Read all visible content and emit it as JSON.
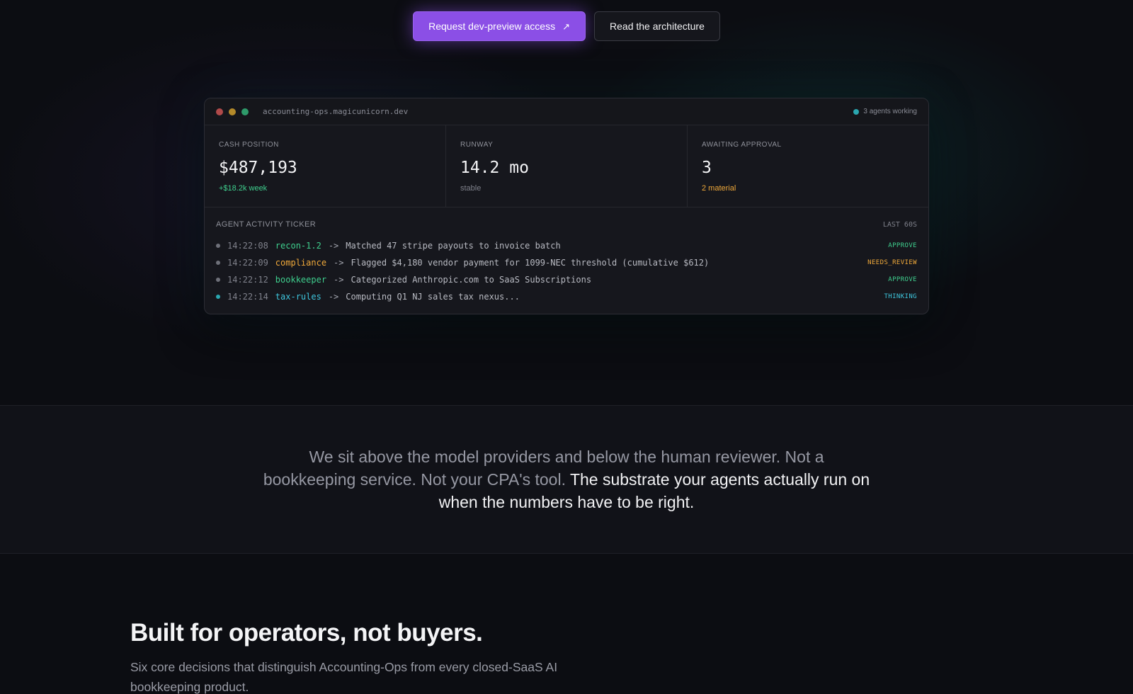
{
  "cta": {
    "primary_label": "Request dev-preview access",
    "primary_icon": "arrow-up-right-icon",
    "secondary_label": "Read the architecture"
  },
  "window": {
    "url": "accounting-ops.magicunicorn.dev",
    "status": "3 agents working"
  },
  "metrics": [
    {
      "label": "CASH POSITION",
      "value": "$487,193",
      "sub": "+$18.2k week"
    },
    {
      "label": "RUNWAY",
      "value": "14.2 mo",
      "sub": "stable"
    },
    {
      "label": "AWAITING APPROVAL",
      "value": "3",
      "sub": "2 material"
    }
  ],
  "ticker": {
    "title": "AGENT ACTIVITY TICKER",
    "window_label": "LAST 60S",
    "rows": [
      {
        "time": "14:22:08",
        "agent": "recon-1.2",
        "arrow": "->",
        "message": "Matched 47 stripe payouts to invoice batch",
        "tag": "APPROVE"
      },
      {
        "time": "14:22:09",
        "agent": "compliance",
        "arrow": "->",
        "message": "Flagged $4,180 vendor payment for 1099-NEC threshold (cumulative $612)",
        "tag": "NEEDS_REVIEW"
      },
      {
        "time": "14:22:12",
        "agent": "bookkeeper",
        "arrow": "->",
        "message": "Categorized Anthropic.com to SaaS Subscriptions",
        "tag": "APPROVE"
      },
      {
        "time": "14:22:14",
        "agent": "tax-rules",
        "arrow": "->",
        "message": "Computing Q1 NJ sales tax nexus...",
        "tag": "THINKING"
      }
    ]
  },
  "statement": {
    "dim": "We sit above the model providers and below the human reviewer. Not a bookkeeping service. Not your CPA's tool.",
    "bright": "The substrate your agents actually run on when the numbers have to be right."
  },
  "features": {
    "title": "Built for operators, not buyers.",
    "subtitle": "Six core decisions that distinguish Accounting-Ops from every closed-SaaS AI bookkeeping product."
  },
  "colors": {
    "accent": "#8b4fe6",
    "green": "#3fcf8e",
    "amber": "#f0a93a",
    "cyan": "#3ec6dd"
  }
}
